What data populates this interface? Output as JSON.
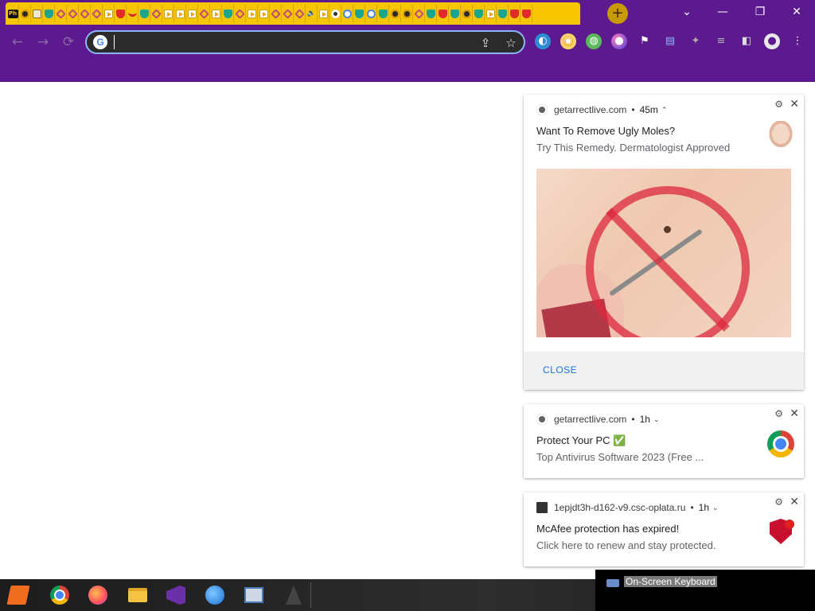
{
  "tabs": {
    "favicons": [
      "ph",
      "snake",
      "doc",
      "shield",
      "tool",
      "tool",
      "tool",
      "tool",
      "play",
      "red",
      "mouth",
      "shield",
      "tool",
      "play",
      "play",
      "play",
      "tool",
      "play",
      "shield",
      "tool",
      "play",
      "play",
      "tool",
      "tool",
      "tool",
      "spk",
      "play",
      "cam",
      "goog",
      "shield",
      "goog",
      "shield",
      "snake",
      "snake",
      "tool",
      "shield",
      "red",
      "shield",
      "snake",
      "shield",
      "play",
      "shield",
      "red",
      "red"
    ],
    "first_tab_label": "Ph",
    "new_tab": "+"
  },
  "window": {
    "tab_search": "⌄",
    "minimize": "—",
    "restore": "❐",
    "close": "✕"
  },
  "toolbar": {
    "back": "←",
    "forward": "→",
    "reload": "⟳",
    "omnibox_value": "",
    "omnibox_placeholder": "",
    "g_logo": "G",
    "share_icon": "⇪",
    "star_icon": "☆",
    "extensions": [
      "◐",
      "◉",
      "◍",
      "●",
      "⚑",
      "▤",
      "✦",
      "≡",
      "◧",
      "●",
      "⋮"
    ]
  },
  "notifications": [
    {
      "source": "getarrectlive.com",
      "time": "45m",
      "caret": "⌃",
      "title": "Want To Remove Ugly Moles?",
      "body": "Try This Remedy. Dermatologist Approved",
      "action": "CLOSE"
    },
    {
      "source": "getarrectlive.com",
      "time": "1h",
      "caret": "⌄",
      "title": "Protect Your PC ✅",
      "body": "Top Antivirus Software 2023 (Free ..."
    },
    {
      "source": "1epjdt3h-d162-v9.csc-oplata.ru",
      "time": "1h",
      "caret": "⌄",
      "title": "McAfee protection has expired!",
      "body": "Click here to renew and stay protected."
    }
  ],
  "notif_controls": {
    "gear": "⚙",
    "close": "✕",
    "sep": "•"
  },
  "osk": {
    "label": "On-Screen Keyboard"
  },
  "colors": {
    "tab_strip": "#f7c600",
    "frame": "#5d1a8e",
    "link_blue": "#1a73e8",
    "omnibox_focus": "#8ab4f8"
  }
}
